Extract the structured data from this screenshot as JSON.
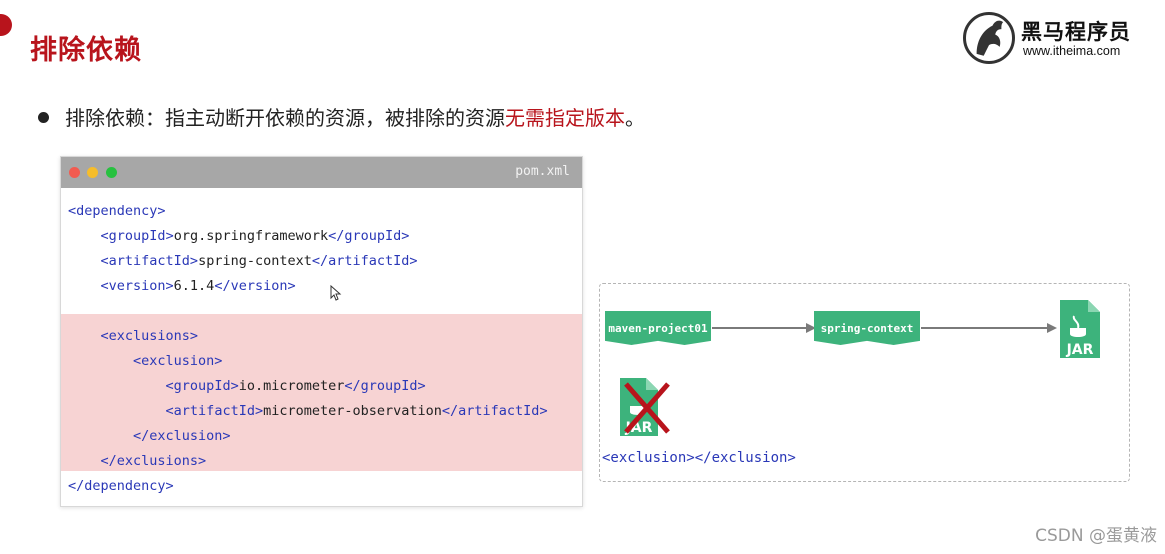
{
  "slide": {
    "title": "排除依赖",
    "bullet_prefix": "排除依赖：指主动断开依赖的资源，被排除的资源",
    "bullet_highlight": "无需指定版本",
    "bullet_suffix": "。"
  },
  "logo": {
    "name": "黑马程序员",
    "url": "www.itheima.com"
  },
  "code": {
    "filename": "pom.xml",
    "lines": [
      [
        {
          "t": "<dependency>",
          "c": "tag"
        }
      ],
      [
        {
          "t": "    "
        },
        {
          "t": "<",
          "c": "tag"
        },
        {
          "t": "groupId",
          "c": "tag"
        },
        {
          "t": ">",
          "c": "tag"
        },
        {
          "t": "org.springframework"
        },
        {
          "t": "</groupId>",
          "c": "tag"
        }
      ],
      [
        {
          "t": "    "
        },
        {
          "t": "<artifactId>",
          "c": "tag"
        },
        {
          "t": "spring-context"
        },
        {
          "t": "</artifactId>",
          "c": "tag"
        }
      ],
      [
        {
          "t": "    "
        },
        {
          "t": "<version>",
          "c": "tag"
        },
        {
          "t": "6.1.4"
        },
        {
          "t": "</version>",
          "c": "tag"
        }
      ],
      [
        {
          "t": ""
        }
      ],
      [
        {
          "t": "    "
        },
        {
          "t": "<exclusions>",
          "c": "tag"
        }
      ],
      [
        {
          "t": "        "
        },
        {
          "t": "<exclusion>",
          "c": "tag"
        }
      ],
      [
        {
          "t": "            "
        },
        {
          "t": "<groupId>",
          "c": "tag"
        },
        {
          "t": "io.micrometer"
        },
        {
          "t": "</groupId>",
          "c": "tag"
        }
      ],
      [
        {
          "t": "            "
        },
        {
          "t": "<artifactId>",
          "c": "tag"
        },
        {
          "t": "micrometer-observation"
        },
        {
          "t": "</artifactId>",
          "c": "tag"
        }
      ],
      [
        {
          "t": "        "
        },
        {
          "t": "</exclusion>",
          "c": "tag"
        }
      ],
      [
        {
          "t": "    "
        },
        {
          "t": "</exclusions>",
          "c": "tag"
        }
      ],
      [
        {
          "t": "</dependency>",
          "c": "tag"
        }
      ]
    ]
  },
  "diagram": {
    "node_maven": "maven-project01",
    "node_spring": "spring-context",
    "jar_label": "JAR",
    "exclusion_label": "<exclusion></exclusion>"
  },
  "watermark": "CSDN @蛋黄液",
  "colors": {
    "accent_red": "#b8141c",
    "tag_blue": "#2a38b7",
    "green": "#3db37c",
    "highlight_pink": "#f7d3d3"
  }
}
